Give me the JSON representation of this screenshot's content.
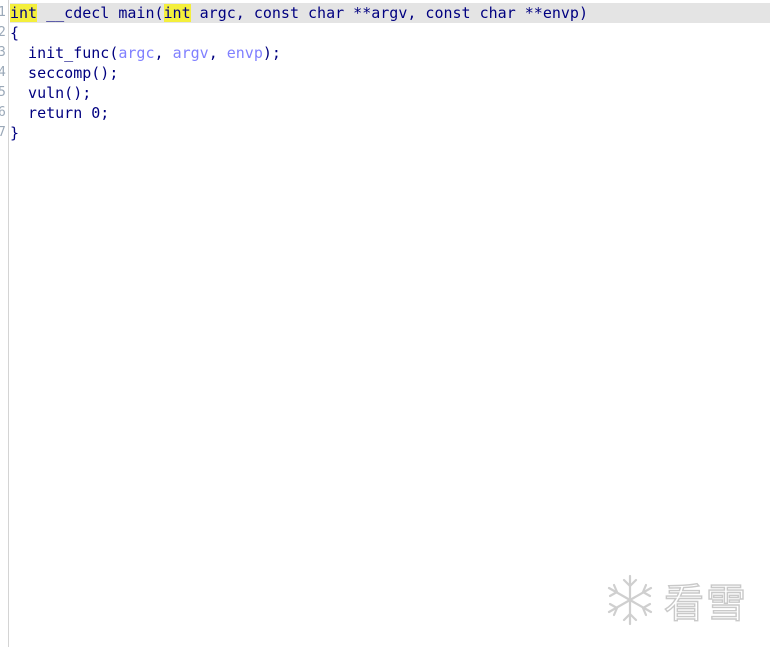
{
  "gutter": {
    "line_numbers": [
      "1",
      "2",
      "3",
      "4",
      "5",
      "6",
      "7"
    ]
  },
  "code": {
    "line1": {
      "t1": "int",
      "t2": " __cdecl main(",
      "t3": "int",
      "t4": " argc, const char **argv, const char **envp)"
    },
    "line2": "{",
    "line3": {
      "t1": "  init_func(",
      "t2": "argc",
      "t3": ", ",
      "t4": "argv",
      "t5": ", ",
      "t6": "envp",
      "t7": ");"
    },
    "line4": "  seccomp();",
    "line5": "  vuln();",
    "line6": "  return 0;",
    "line7": "}"
  },
  "watermark": {
    "text": "看雪",
    "icon": "snowflake-icon"
  },
  "colors": {
    "code_text": "#000080",
    "argument": "#8080ff",
    "keyword_highlight": "#f4ef3c",
    "current_line": "#e4e4e4"
  }
}
